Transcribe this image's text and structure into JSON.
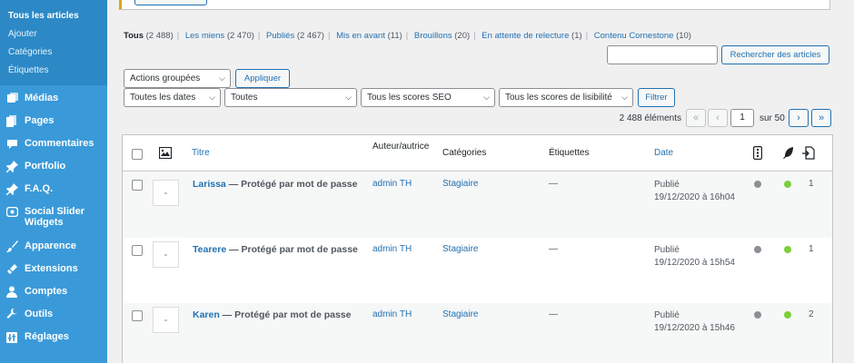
{
  "sidebar": {
    "sub_items": [
      "Tous les articles",
      "Ajouter",
      "Catégories",
      "Étiquettes"
    ],
    "menu": [
      {
        "label": "Médias",
        "icon": "media-icon"
      },
      {
        "label": "Pages",
        "icon": "pages-icon"
      },
      {
        "label": "Commentaires",
        "icon": "comments-icon"
      },
      {
        "label": "Portfolio",
        "icon": "pin-icon"
      },
      {
        "label": "F.A.Q.",
        "icon": "pin-icon"
      },
      {
        "label": "Social Slider Widgets",
        "icon": "slider-icon"
      },
      {
        "label": "Apparence",
        "icon": "brush-icon"
      },
      {
        "label": "Extensions",
        "icon": "plug-icon"
      },
      {
        "label": "Comptes",
        "icon": "user-icon"
      },
      {
        "label": "Outils",
        "icon": "wrench-icon"
      },
      {
        "label": "Réglages",
        "icon": "settings-icon"
      }
    ]
  },
  "views": {
    "all": "Tous",
    "all_count": "(2 488)",
    "mine": "Les miens",
    "mine_count": "(2 470)",
    "published": "Publiés",
    "published_count": "(2 467)",
    "featured": "Mis en avant",
    "featured_count": "(11)",
    "drafts": "Brouillons",
    "drafts_count": "(20)",
    "pending": "En attente de relecture",
    "pending_count": "(1)",
    "cornerstone": "Contenu Cornestone",
    "cornerstone_count": "(10)"
  },
  "search": {
    "button": "Rechercher des articles",
    "value": ""
  },
  "bulk": {
    "select": "Actions groupées",
    "apply": "Appliquer"
  },
  "filters": {
    "dates": "Toutes les dates",
    "categories": "Toutes",
    "seo": "Tous les scores SEO",
    "readability": "Tous les scores de lisibilité",
    "button": "Filtrer"
  },
  "pagination": {
    "count": "2 488 éléments",
    "first": "«",
    "prev": "‹",
    "current": "1",
    "of": "sur 50",
    "next": "›",
    "last": "»"
  },
  "table": {
    "headers": {
      "title": "Titre",
      "author": "Auteur/autrice",
      "categories": "Catégories",
      "tags": "Étiquettes",
      "date": "Date"
    },
    "rows": [
      {
        "title": "Larissa",
        "state": " — Protégé par mot de passe",
        "author": "admin TH",
        "category": "Stagiaire",
        "tags": "—",
        "status": "Publié",
        "date": "19/12/2020 à 16h04",
        "links": "1"
      },
      {
        "title": "Tearere",
        "state": " — Protégé par mot de passe",
        "author": "admin TH",
        "category": "Stagiaire",
        "tags": "—",
        "status": "Publié",
        "date": "19/12/2020 à 15h54",
        "links": "1"
      },
      {
        "title": "Karen",
        "state": " — Protégé par mot de passe",
        "author": "admin TH",
        "category": "Stagiaire",
        "tags": "—",
        "status": "Publié",
        "date": "19/12/2020 à 15h46",
        "links": "2"
      }
    ]
  },
  "colors": {
    "seo_dot": "#8c8f94",
    "readability_dot": "#7ad03a",
    "accent": "#2271b1",
    "sidebar": "#3a9ad9"
  }
}
